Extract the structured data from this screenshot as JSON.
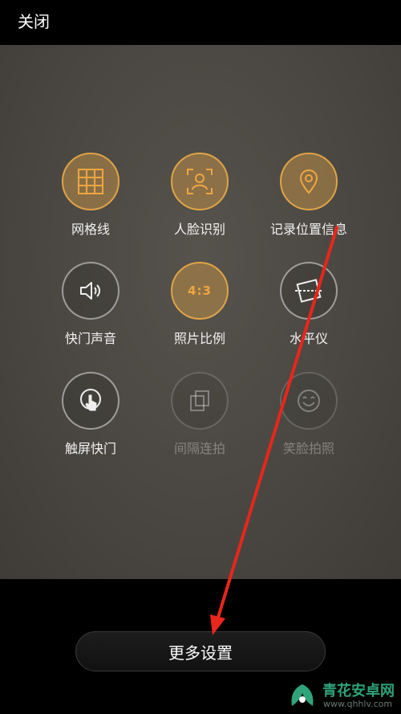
{
  "topbar": {
    "close_label": "关闭"
  },
  "settings": [
    {
      "label": "网格线",
      "state": "on",
      "icon": "grid-icon"
    },
    {
      "label": "人脸识别",
      "state": "on",
      "icon": "face-recognition-icon"
    },
    {
      "label": "记录位置信息",
      "state": "on",
      "icon": "location-pin-icon"
    },
    {
      "label": "快门声音",
      "state": "off",
      "icon": "speaker-icon"
    },
    {
      "label": "照片比例",
      "state": "on",
      "icon": "aspect-ratio-icon",
      "badge": "4:3"
    },
    {
      "label": "水平仪",
      "state": "off",
      "icon": "level-icon"
    },
    {
      "label": "触屏快门",
      "state": "off",
      "icon": "touch-shutter-icon"
    },
    {
      "label": "间隔连拍",
      "state": "disabled",
      "icon": "burst-icon"
    },
    {
      "label": "笑脸拍照",
      "state": "disabled",
      "icon": "smile-icon"
    }
  ],
  "more_settings_label": "更多设置",
  "watermark": {
    "title": "青花安卓网",
    "url": "www.qhhlv.com"
  },
  "colors": {
    "accent": "#e0a347",
    "arrow": "#e8261c",
    "watermark": "#2fa37a"
  }
}
